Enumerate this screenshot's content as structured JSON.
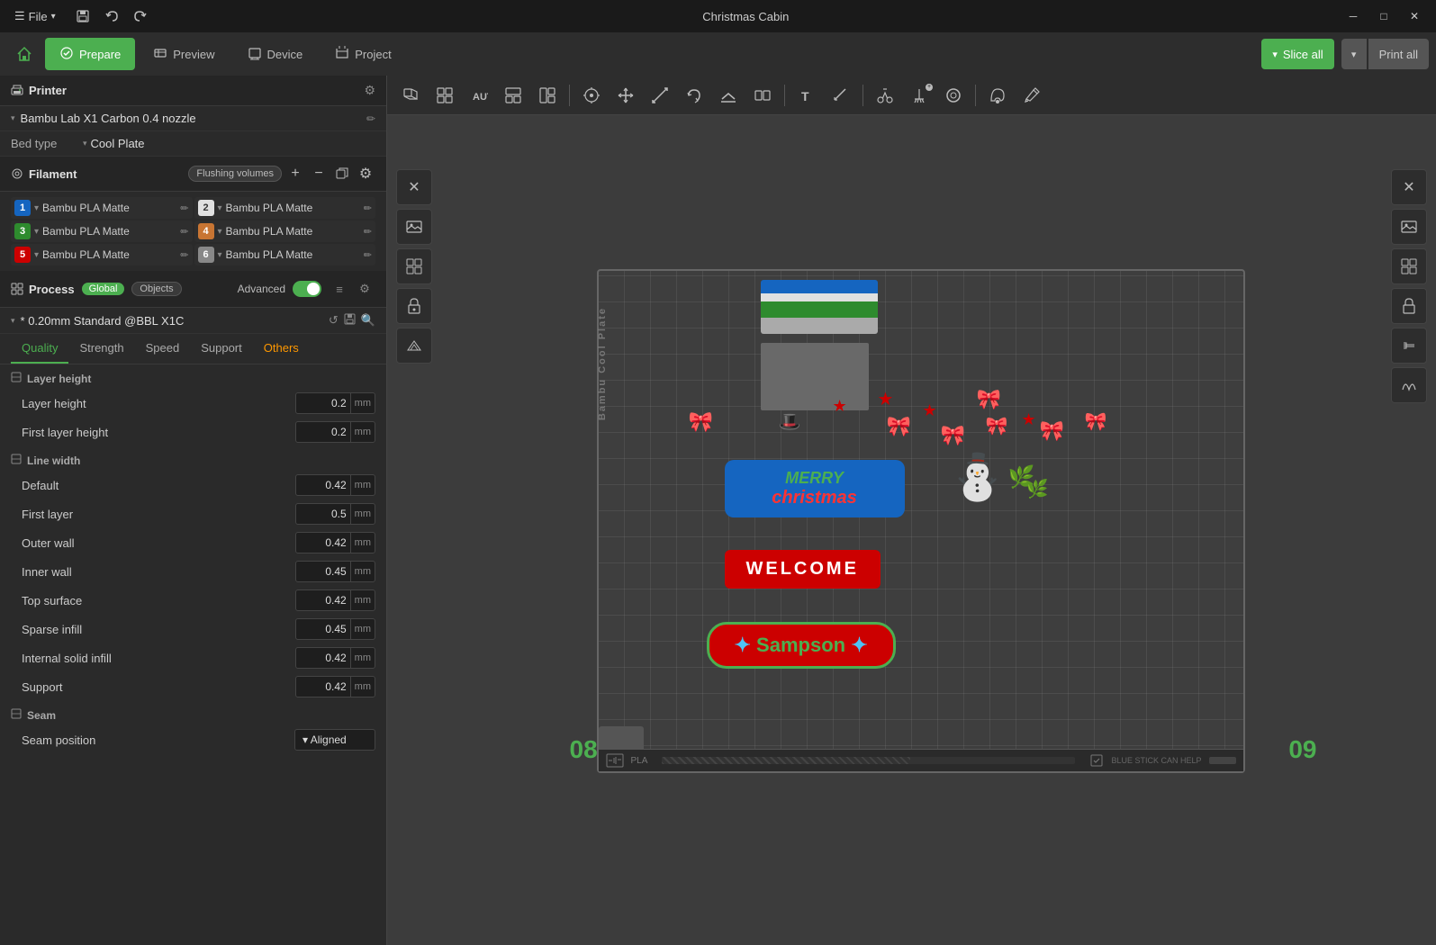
{
  "titlebar": {
    "title": "Christmas Cabin",
    "menu": "File",
    "minimize": "─",
    "maximize": "□",
    "close": "✕"
  },
  "navbar": {
    "prepare_label": "Prepare",
    "preview_label": "Preview",
    "device_label": "Device",
    "project_label": "Project",
    "slice_all_label": "Slice all",
    "print_all_label": "Print all"
  },
  "sidebar": {
    "printer_title": "Printer",
    "printer_name": "Bambu Lab X1 Carbon 0.4 nozzle",
    "bed_type_label": "Bed type",
    "bed_type_value": "Cool Plate",
    "filament_title": "Filament",
    "flushing_label": "Flushing volumes",
    "filaments": [
      {
        "num": "1",
        "color": "#1565c0",
        "name": "Bambu PLA Matte",
        "text_color": "#fff"
      },
      {
        "num": "2",
        "color": "#e0e0e0",
        "name": "Bambu PLA Matte",
        "text_color": "#333"
      },
      {
        "num": "3",
        "color": "#2e8b2e",
        "name": "Bambu PLA Matte",
        "text_color": "#fff"
      },
      {
        "num": "4",
        "color": "#c87533",
        "name": "Bambu PLA Matte",
        "text_color": "#fff"
      },
      {
        "num": "5",
        "color": "#cc0000",
        "name": "Bambu PLA Matte",
        "text_color": "#fff"
      },
      {
        "num": "6",
        "color": "#888888",
        "name": "Bambu PLA Matte",
        "text_color": "#fff"
      }
    ],
    "process_title": "Process",
    "global_label": "Global",
    "objects_label": "Objects",
    "advanced_label": "Advanced",
    "preset_name": "* 0.20mm Standard @BBL X1C",
    "tabs": [
      "Quality",
      "Strength",
      "Speed",
      "Support",
      "Others"
    ],
    "active_tab": "Quality",
    "layer_height_group": "Layer height",
    "settings": [
      {
        "label": "Layer height",
        "value": "0.2",
        "unit": "mm"
      },
      {
        "label": "First layer height",
        "value": "0.2",
        "unit": "mm"
      }
    ],
    "line_width_group": "Line width",
    "line_widths": [
      {
        "label": "Default",
        "value": "0.42",
        "unit": "mm"
      },
      {
        "label": "First layer",
        "value": "0.5",
        "unit": "mm"
      },
      {
        "label": "Outer wall",
        "value": "0.42",
        "unit": "mm"
      },
      {
        "label": "Inner wall",
        "value": "0.45",
        "unit": "mm"
      },
      {
        "label": "Top surface",
        "value": "0.42",
        "unit": "mm"
      },
      {
        "label": "Sparse infill",
        "value": "0.45",
        "unit": "mm"
      },
      {
        "label": "Internal solid infill",
        "value": "0.42",
        "unit": "mm"
      },
      {
        "label": "Support",
        "value": "0.42",
        "unit": "mm"
      }
    ],
    "seam_group": "Seam",
    "seam_settings": [
      {
        "label": "Seam position",
        "value": "Aligned",
        "unit": ""
      }
    ]
  },
  "viewport": {
    "corner_bl": "08",
    "corner_br": "09",
    "bed_label": "Bambu Cool Plate",
    "pla_label": "PLA",
    "blue_stick_label": "BLUE STICK CAN HELP"
  },
  "icons": {
    "menu": "☰",
    "save": "💾",
    "undo": "↩",
    "redo": "↪",
    "settings": "⚙",
    "edit": "✏",
    "add": "+",
    "remove": "−",
    "copy": "⧉",
    "search": "🔍",
    "refresh": "↺",
    "dropdown": "▾",
    "chevron_down": "▾",
    "list": "≡",
    "tune": "⚙",
    "x_close": "✕",
    "lock": "🔒",
    "layers": "⧉",
    "move": "✥",
    "scale": "⇲",
    "rotate": "↻",
    "mirror": "⇔",
    "auto": "A",
    "grid": "⊞",
    "orient": "⊡",
    "arrange": "⊟",
    "cut": "✂",
    "support": "⊥",
    "hollow": "◻",
    "measure": "📏",
    "print": "🖨"
  }
}
